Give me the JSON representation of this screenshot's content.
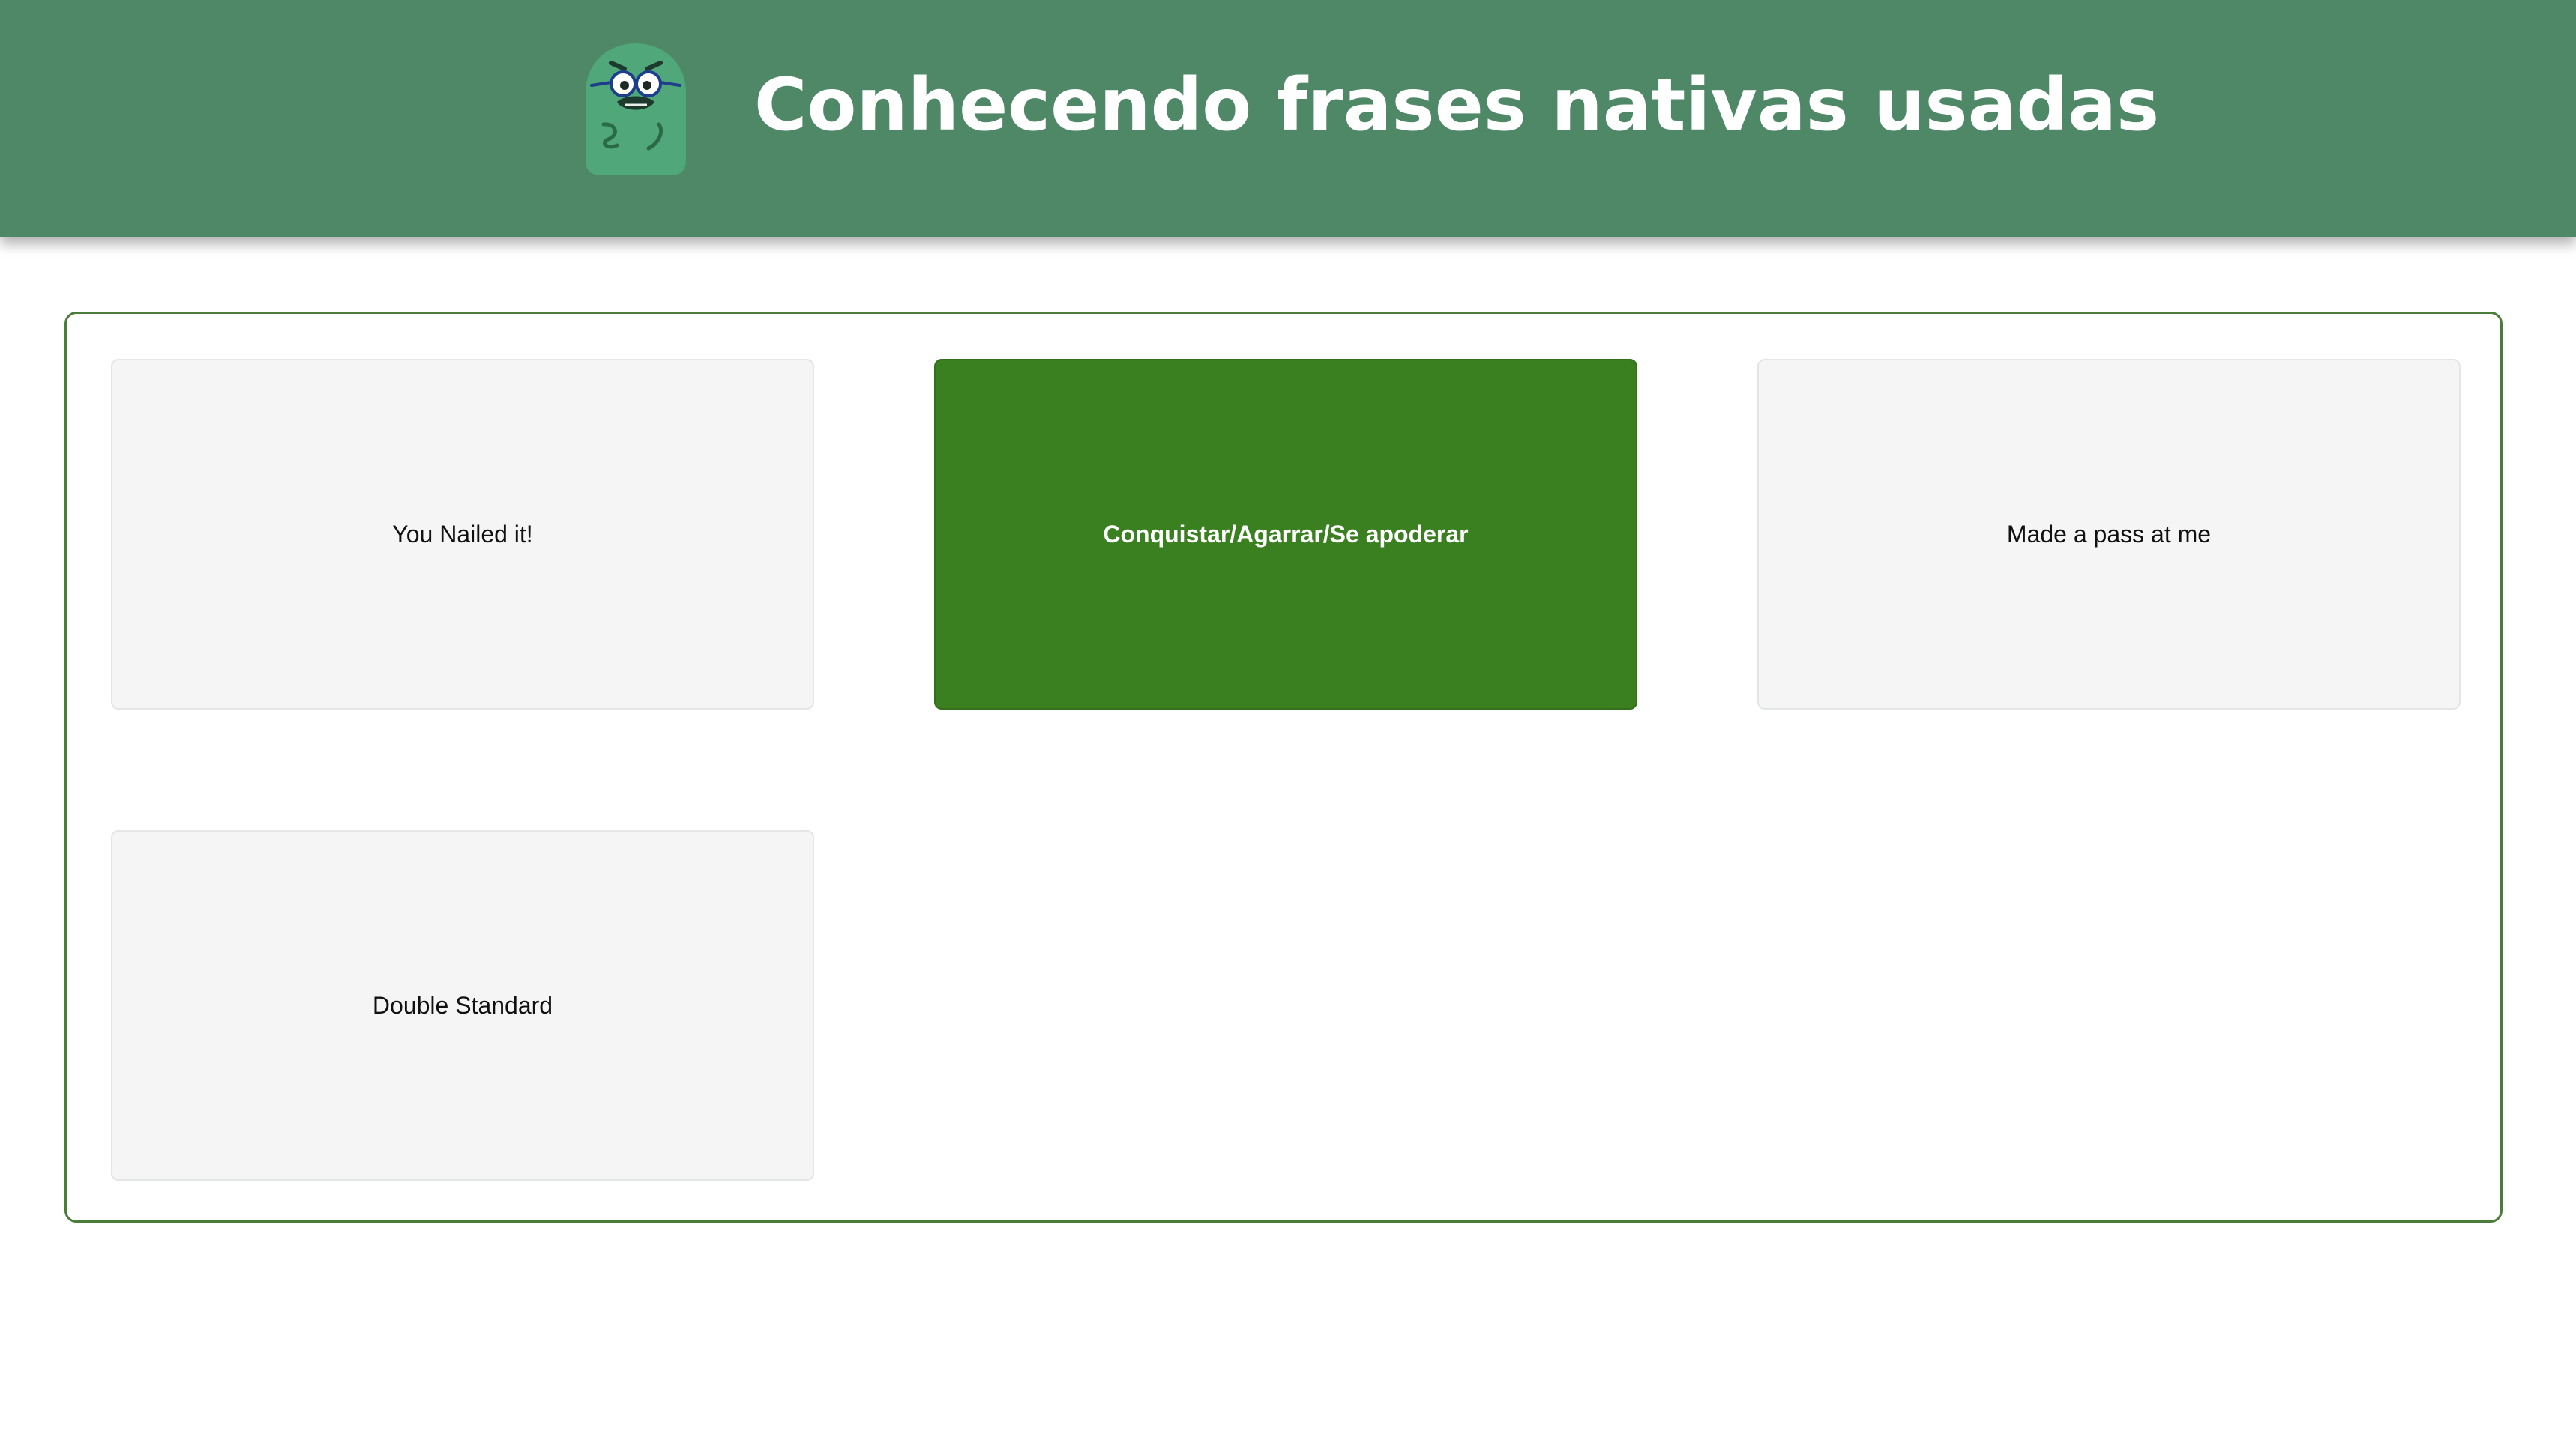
{
  "header": {
    "title": "Conhecendo frases nativas usadas",
    "background_color": "#4f8867",
    "mascot_icon": "green-monster-mascot-icon"
  },
  "board": {
    "border_color": "#4a7c3a",
    "cards": [
      {
        "label": "You Nailed it!",
        "selected": false
      },
      {
        "label": "Conquistar/Agarrar/Se apoderar",
        "selected": true
      },
      {
        "label": "Made a pass at me",
        "selected": false
      },
      {
        "label": "Double Standard",
        "selected": false
      }
    ],
    "selected_color": "#3a7f20",
    "card_color": "#f5f5f5"
  }
}
